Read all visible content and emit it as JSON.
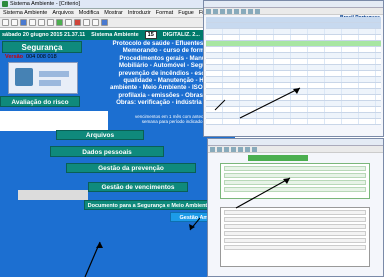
{
  "window": {
    "title": "Sistema Ambiente - [Criterio]"
  },
  "menu": [
    "Sistema Ambiente",
    "Arquivos",
    "Modifica",
    "Mostrar",
    "Introduzir",
    "Format",
    "Fugue",
    "Fichei",
    "Wi"
  ],
  "status": {
    "date": "sábado 20 giugno 2015  21.37.11",
    "app_name": "Sistema Ambiente",
    "counter": "15",
    "label": "DIGITALIZ. 2..."
  },
  "panel": {
    "title": "Segurança",
    "versao_label": "Versão",
    "versao_codes": "004  008  018"
  },
  "info_text": "Protocolo de saúde - Efluentes líquidos - Memorando - curso de formação - Procedimentos gerais - Manutenção Mobiliário - Automóvel - Segurança - prevenção de incêndios - escritório - qualidade - Manutenção - Higiene ambiente - Meio Ambiente - ISO - higiene e profilaxia - emissões - Obras: início - Obras: verificação - indústria extrativa",
  "info_sub": "vencimentos em 1 mês com antecedência de 1 semana para período indicado (6 meses",
  "buttons": {
    "avaliacao": "Avaliação do risco",
    "arquivos": "Arquivos",
    "dados": "Dados pessoais",
    "prevencao": "Gestão da prevenção",
    "vencimentos": "Gestão de vencimentos",
    "documento": "Documento para a Segurança e Meio Ambiente",
    "gestao_amb": "Gestão Ambiente"
  },
  "worksheet": {
    "brand": "Brasil Portugues"
  },
  "colors": {
    "teal": "#0f8a7c",
    "blue": "#1c6fd1",
    "green_bar": "#007a6b",
    "accent_red": "#cc0000"
  }
}
